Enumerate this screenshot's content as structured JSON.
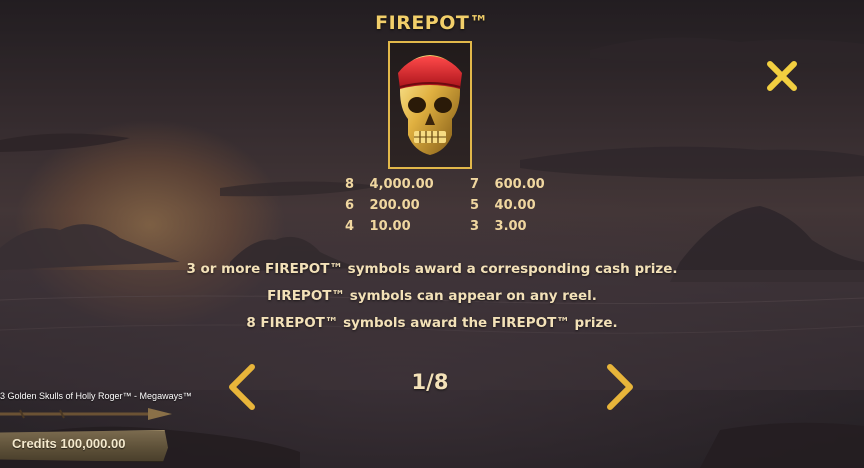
{
  "screen": {
    "title": "FIREPOT™",
    "symbol_icon": "golden-skull-red-bandana-icon"
  },
  "paytable": {
    "left": [
      {
        "count": "8",
        "value": "4,000.00"
      },
      {
        "count": "6",
        "value": "200.00"
      },
      {
        "count": "4",
        "value": "10.00"
      }
    ],
    "right": [
      {
        "count": "7",
        "value": "600.00"
      },
      {
        "count": "5",
        "value": "40.00"
      },
      {
        "count": "3",
        "value": "3.00"
      }
    ]
  },
  "description": [
    "3 or more FIREPOT™ symbols award a corresponding cash prize.",
    "FIREPOT™ symbols can appear on any reel.",
    "8 FIREPOT™ symbols award the FIREPOT™ prize."
  ],
  "pagination": {
    "indicator": "1/8",
    "current_page": 1,
    "total_pages": 8
  },
  "footer": {
    "game_title": "3 Golden Skulls of Holly Roger™ - Megaways™",
    "credits_label": "Credits 100,000.00"
  },
  "colors": {
    "accent_gold": "#f2cf6a",
    "text_cream": "#f3e1b8",
    "frame_gold": "#e2b84a"
  }
}
